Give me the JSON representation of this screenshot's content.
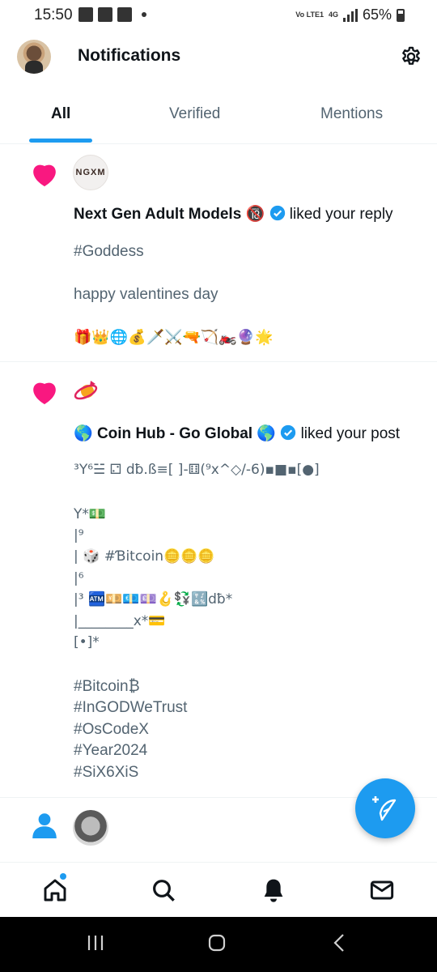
{
  "status_bar": {
    "time": "15:50",
    "network": "Vo LTE1",
    "network_type": "4G",
    "battery": "65%"
  },
  "header": {
    "title": "Notifications"
  },
  "tabs": [
    {
      "label": "All",
      "active": true
    },
    {
      "label": "Verified",
      "active": false
    },
    {
      "label": "Mentions",
      "active": false
    }
  ],
  "notifications": [
    {
      "icon": "heart-icon",
      "avatar_text": "NGXM",
      "actor": "Next Gen Adult Models",
      "actor_badge": "🔞",
      "action": "liked your reply",
      "lines": [
        "#Goddess",
        "",
        "happy valentines day",
        "",
        "🎁👑🌐💰🗡️⚔️🔫🏹🏍️🔮🌟"
      ]
    },
    {
      "icon": "heart-icon",
      "actor_prefix": "🌎",
      "actor": "Coin Hub - Go Global",
      "actor_suffix": "🌎",
      "action": "liked your post",
      "lines": [
        "³Y⁶☱ ⚁ dƀ.ß≡[ ]-⚅(⁹x^◇/-6)▪■▪[●]",
        "",
        "Y*💵",
        "|⁹",
        "|         🎲 #Ɓitcoin🪙🪙🪙",
        "|⁶",
        "|³        🏧💴💶💷🪝💱🔣dƀ*",
        "|________x*💳",
        "[•]*",
        "",
        "#Bitcoin₿",
        "#InGODWeTrust",
        "#OsCodeX",
        "#Year2024",
        "#SiX6XiS"
      ]
    },
    {
      "icon": "person-icon"
    }
  ],
  "colors": {
    "accent": "#1d9bf0",
    "heart": "#f91880",
    "text": "#0f1419",
    "secondary": "#536471"
  },
  "bottom_nav": [
    "home-icon",
    "search-icon",
    "bell-icon",
    "mail-icon"
  ]
}
